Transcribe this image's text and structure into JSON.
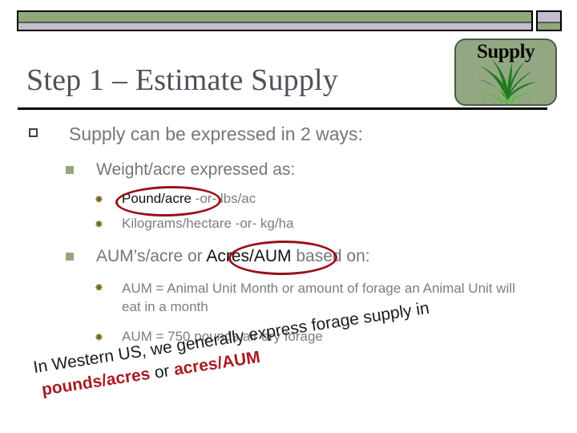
{
  "slide": {
    "title": "Step 1 – Estimate Supply",
    "logo": {
      "label": "Supply",
      "icon": "grass-plant-icon",
      "background_color": "#93a882"
    },
    "decor": {
      "bar_green": "#8fa878",
      "bar_lavender": "#c3bfce",
      "rule_color": "#000000"
    },
    "highlight_color": "#9a1118",
    "annotation_red": "#a81b22"
  },
  "content": {
    "level1": {
      "bullet": "hollow-square-bullet",
      "text": "Supply can be expressed in 2 ways:"
    },
    "level2": [
      {
        "bullet": "filled-square-bullet",
        "text": "Weight/acre expressed as:"
      },
      {
        "bullet": "filled-square-bullet",
        "text_before": "AUM’s/acre or ",
        "circled_term": "Acres/AUM",
        "text_after": " based on:"
      }
    ],
    "group1_items": [
      {
        "bullet": "star-bullet",
        "circled_term": "Pound/acre",
        "text_after": "  -or-   lbs/ac"
      },
      {
        "bullet": "star-bullet",
        "text": "Kilograms/hectare   -or-  kg/ha"
      }
    ],
    "group2_items": [
      {
        "bullet": "star-bullet",
        "text": "AUM = Animal Unit Month or amount of forage an Animal Unit will eat in a month"
      },
      {
        "bullet": "star-bullet",
        "text": "AUM = 750 pounds air dry forage"
      }
    ]
  },
  "annotation": {
    "line1_plain": "In Western US, we generally express forage supply in",
    "line2_red_a": "pounds/acres",
    "line2_plain": " or ",
    "line2_red_b": "acres/AUM"
  }
}
